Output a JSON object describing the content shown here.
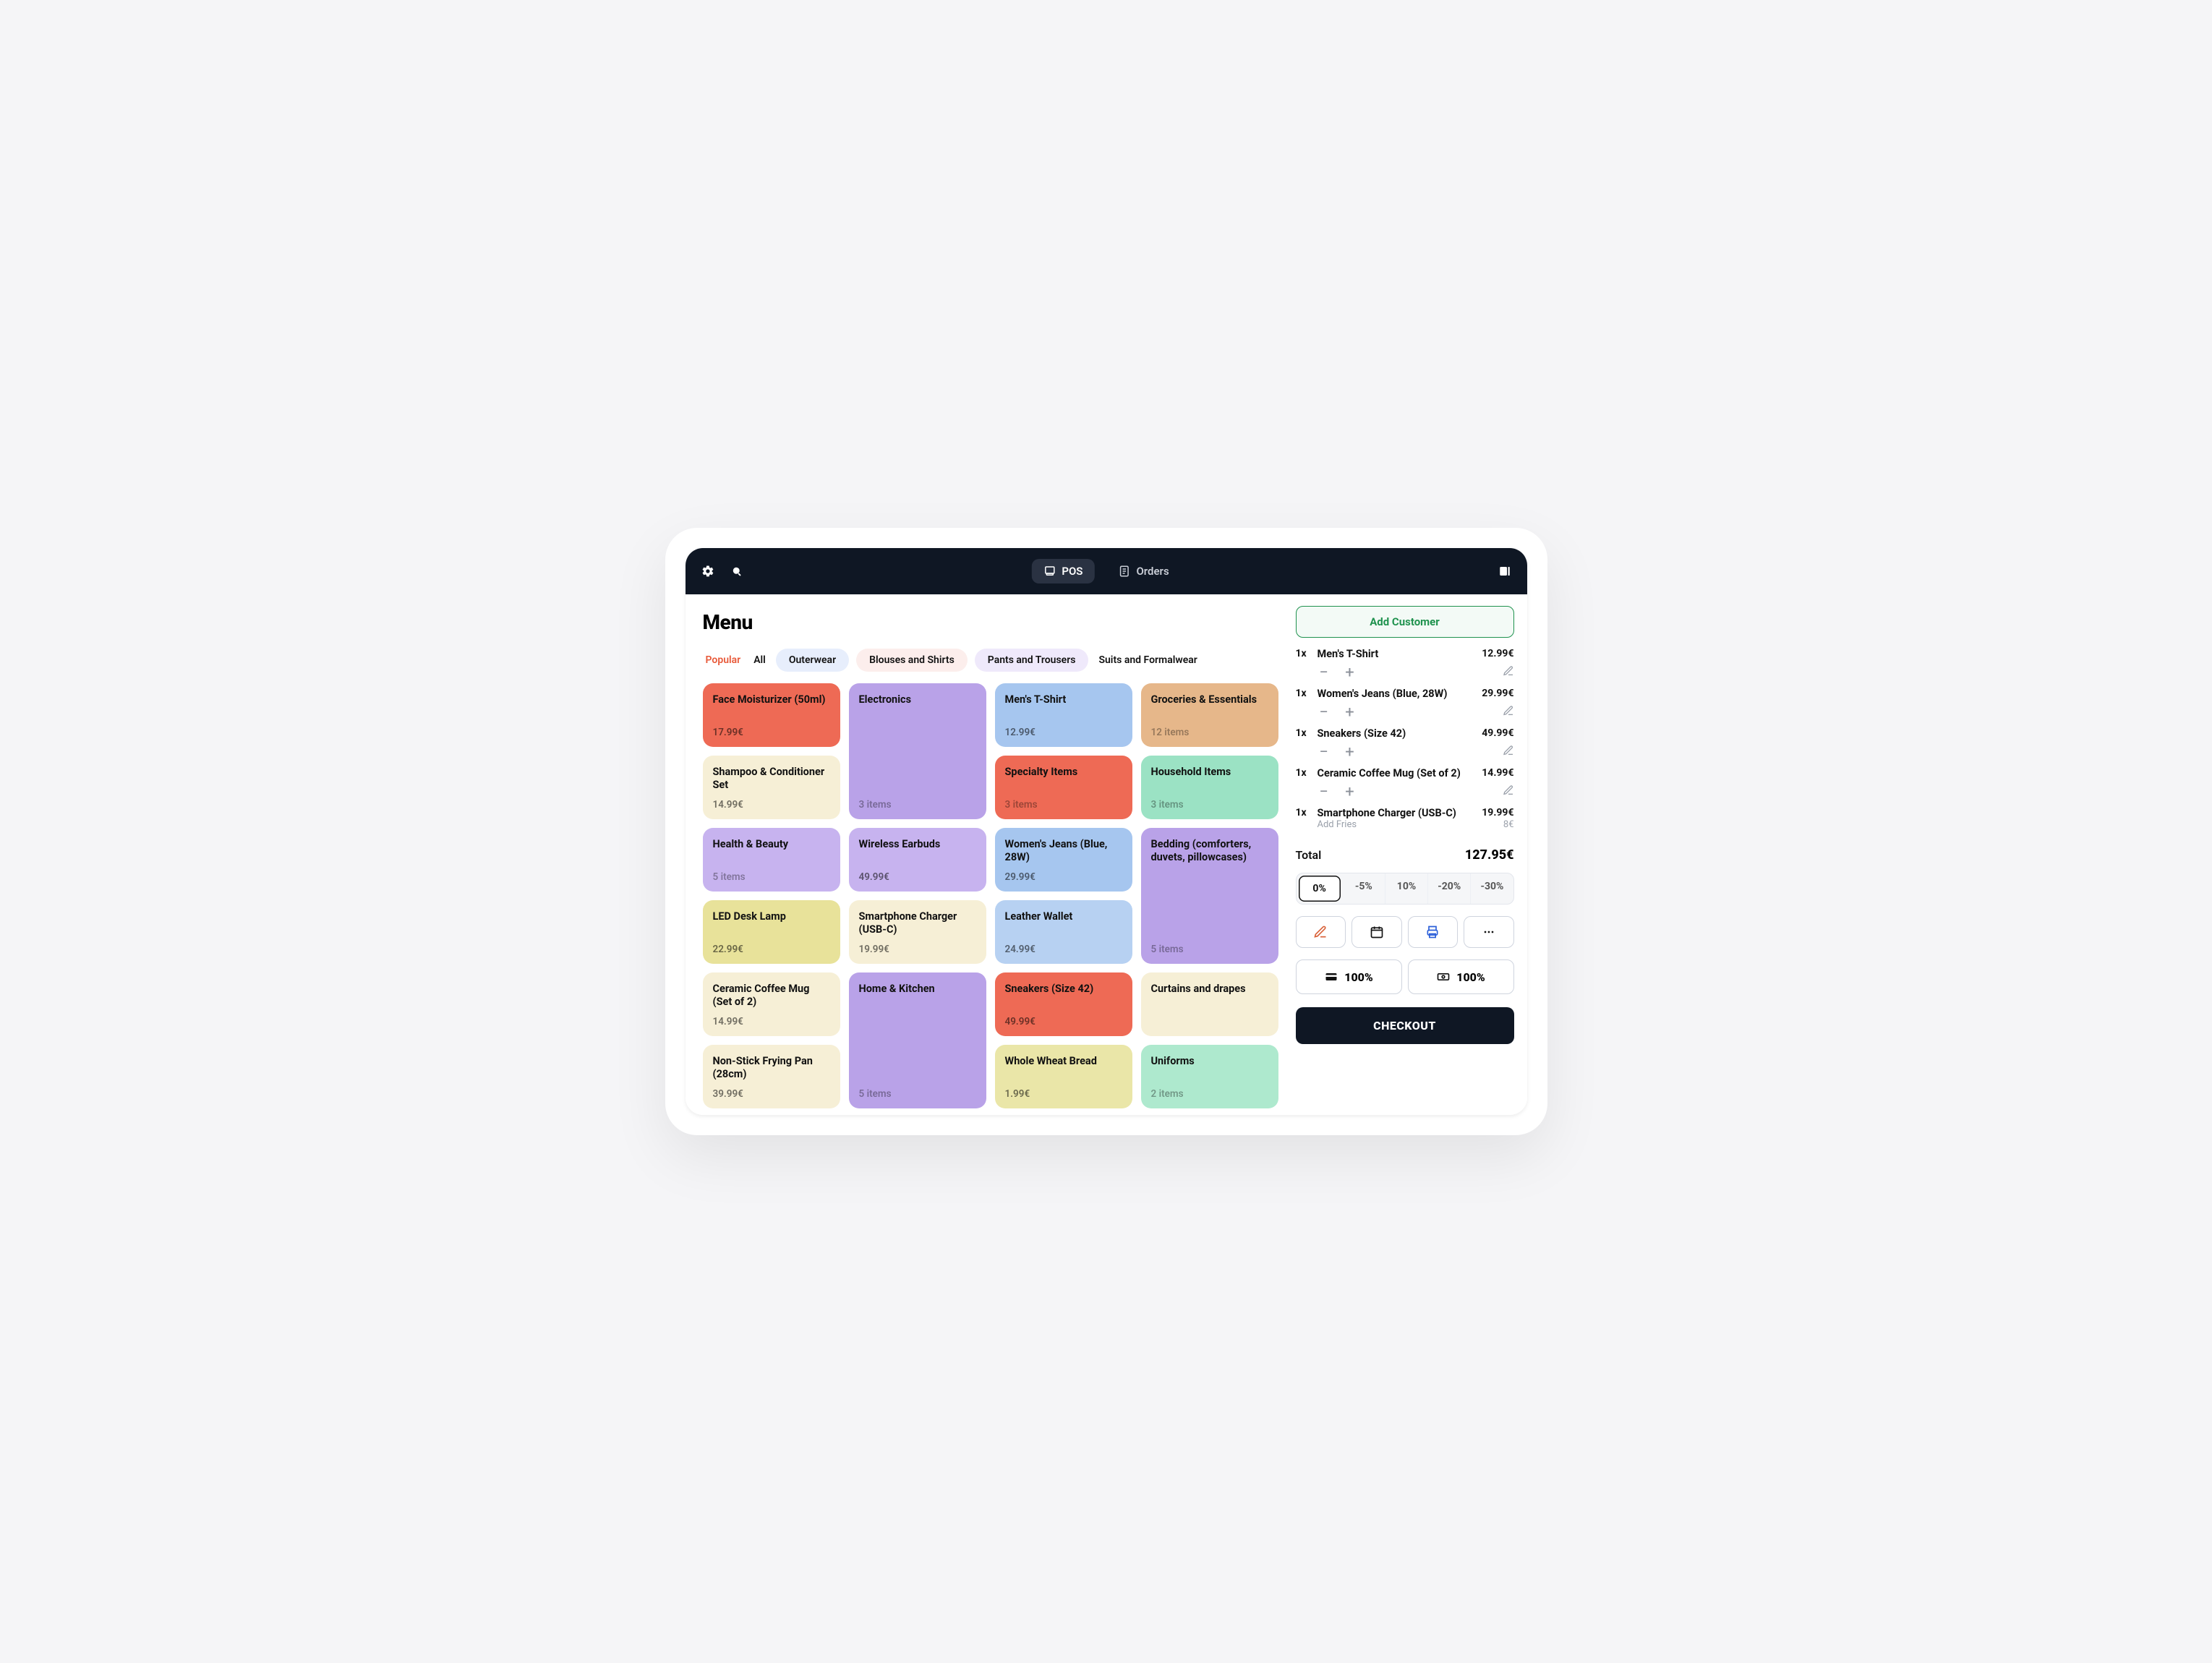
{
  "nav": {
    "pos": "POS",
    "orders": "Orders"
  },
  "menu": {
    "title": "Menu",
    "chips": {
      "popular": "Popular",
      "all": "All",
      "outerwear": "Outerwear",
      "blouses": "Blouses and Shirts",
      "pants": "Pants and Trousers",
      "suits": "Suits and Formalwear"
    },
    "col1": {
      "face": {
        "name": "Face Moisturizer (50ml)",
        "price": "17.99€"
      },
      "shampoo": {
        "name": "Shampoo & Conditioner Set",
        "price": "14.99€"
      },
      "health": {
        "name": "Health & Beauty",
        "sub": "5 items"
      },
      "lamp": {
        "name": "LED Desk Lamp",
        "price": "22.99€"
      },
      "mug": {
        "name": "Ceramic Coffee Mug (Set of 2)",
        "price": "14.99€"
      },
      "pan": {
        "name": "Non-Stick Frying Pan (28cm)",
        "price": "39.99€"
      }
    },
    "col2": {
      "elec": {
        "name": "Electronics",
        "sub": "3 items"
      },
      "earbuds": {
        "name": "Wireless Earbuds",
        "price": "49.99€"
      },
      "charger": {
        "name": "Smartphone Charger (USB-C)",
        "price": "19.99€"
      },
      "home": {
        "name": "Home & Kitchen",
        "sub": "5 items"
      }
    },
    "col3": {
      "tshirt": {
        "name": "Men's T-Shirt",
        "price": "12.99€"
      },
      "spec": {
        "name": "Specialty Items",
        "sub": "3 items"
      },
      "jeans": {
        "name": "Women's Jeans (Blue, 28W)",
        "price": "29.99€"
      },
      "wallet": {
        "name": "Leather Wallet",
        "price": "24.99€"
      },
      "sneak": {
        "name": "Sneakers (Size 42)",
        "price": "49.99€"
      },
      "bread": {
        "name": "Whole Wheat Bread",
        "price": "1.99€"
      }
    },
    "col4": {
      "groc": {
        "name": "Groceries & Essentials",
        "sub": "12 items"
      },
      "house": {
        "name": "Household Items",
        "sub": "3 items"
      },
      "bed": {
        "name": "Bedding (comforters, duvets, pillowcases)",
        "sub": "5 items"
      },
      "curt": {
        "name": "Curtains and drapes",
        "sub": ""
      },
      "unif": {
        "name": "Uniforms",
        "sub": "2 items"
      }
    }
  },
  "cart": {
    "addCustomer": "Add Customer",
    "items": [
      {
        "qty": "1x",
        "name": "Men's T-Shirt",
        "price": "12.99€"
      },
      {
        "qty": "1x",
        "name": "Women's Jeans (Blue, 28W)",
        "price": "29.99€"
      },
      {
        "qty": "1x",
        "name": "Sneakers (Size 42)",
        "price": "49.99€"
      },
      {
        "qty": "1x",
        "name": "Ceramic Coffee Mug (Set of 2)",
        "price": "14.99€"
      },
      {
        "qty": "1x",
        "name": "Smartphone Charger (USB-C)",
        "price": "19.99€",
        "addon": "Add Fries",
        "addonPrice": "8€"
      }
    ],
    "totalLabel": "Total",
    "totalValue": "127.95€",
    "discounts": [
      "0%",
      "-5%",
      "10%",
      "-20%",
      "-30%"
    ],
    "pay100a": "100%",
    "pay100b": "100%",
    "checkout": "CHECKOUT"
  }
}
